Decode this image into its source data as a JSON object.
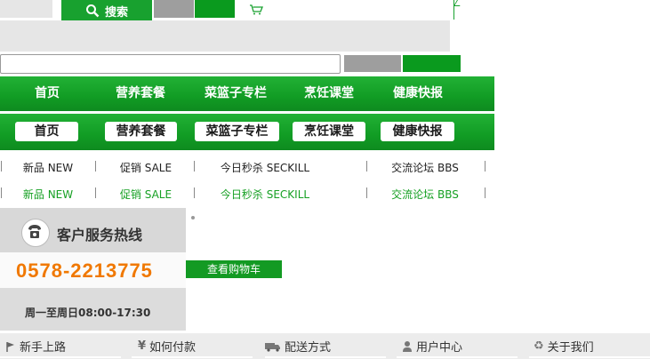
{
  "search": {
    "button_label": "搜索"
  },
  "nav_primary": [
    {
      "label": "首页"
    },
    {
      "label": "营养套餐"
    },
    {
      "label": "菜篮子专栏"
    },
    {
      "label": "烹饪课堂"
    },
    {
      "label": "健康快报"
    }
  ],
  "nav_secondary": [
    {
      "label": "首页"
    },
    {
      "label": "营养套餐"
    },
    {
      "label": "菜篮子专栏"
    },
    {
      "label": "烹饪课堂"
    },
    {
      "label": "健康快报"
    }
  ],
  "subnav_dark": [
    {
      "label": "新品 NEW"
    },
    {
      "label": "促销 SALE"
    },
    {
      "label": "今日秒杀  SECKILL"
    },
    {
      "label": "交流论坛  BBS"
    }
  ],
  "subnav_green": [
    {
      "label": "新品 NEW"
    },
    {
      "label": "促销 SALE"
    },
    {
      "label": "今日秒杀  SECKILL"
    },
    {
      "label": "交流论坛  BBS"
    }
  ],
  "hotline": {
    "title": "客户服务热线",
    "phone": "0578-2213775",
    "hours": "周一至周日08:00-17:30"
  },
  "cart": {
    "view_label": "查看购物车"
  },
  "footer": [
    {
      "label": "新手上路",
      "icon": "flag-icon"
    },
    {
      "label": "如何付款",
      "icon": "yen-icon"
    },
    {
      "label": "配送方式",
      "icon": "truck-icon"
    },
    {
      "label": "用户中心",
      "icon": "user-icon"
    },
    {
      "label": "关于我们",
      "icon": "recycle-icon"
    }
  ],
  "colors": {
    "brand_green": "#18a12f",
    "phone_orange": "#f07800"
  }
}
